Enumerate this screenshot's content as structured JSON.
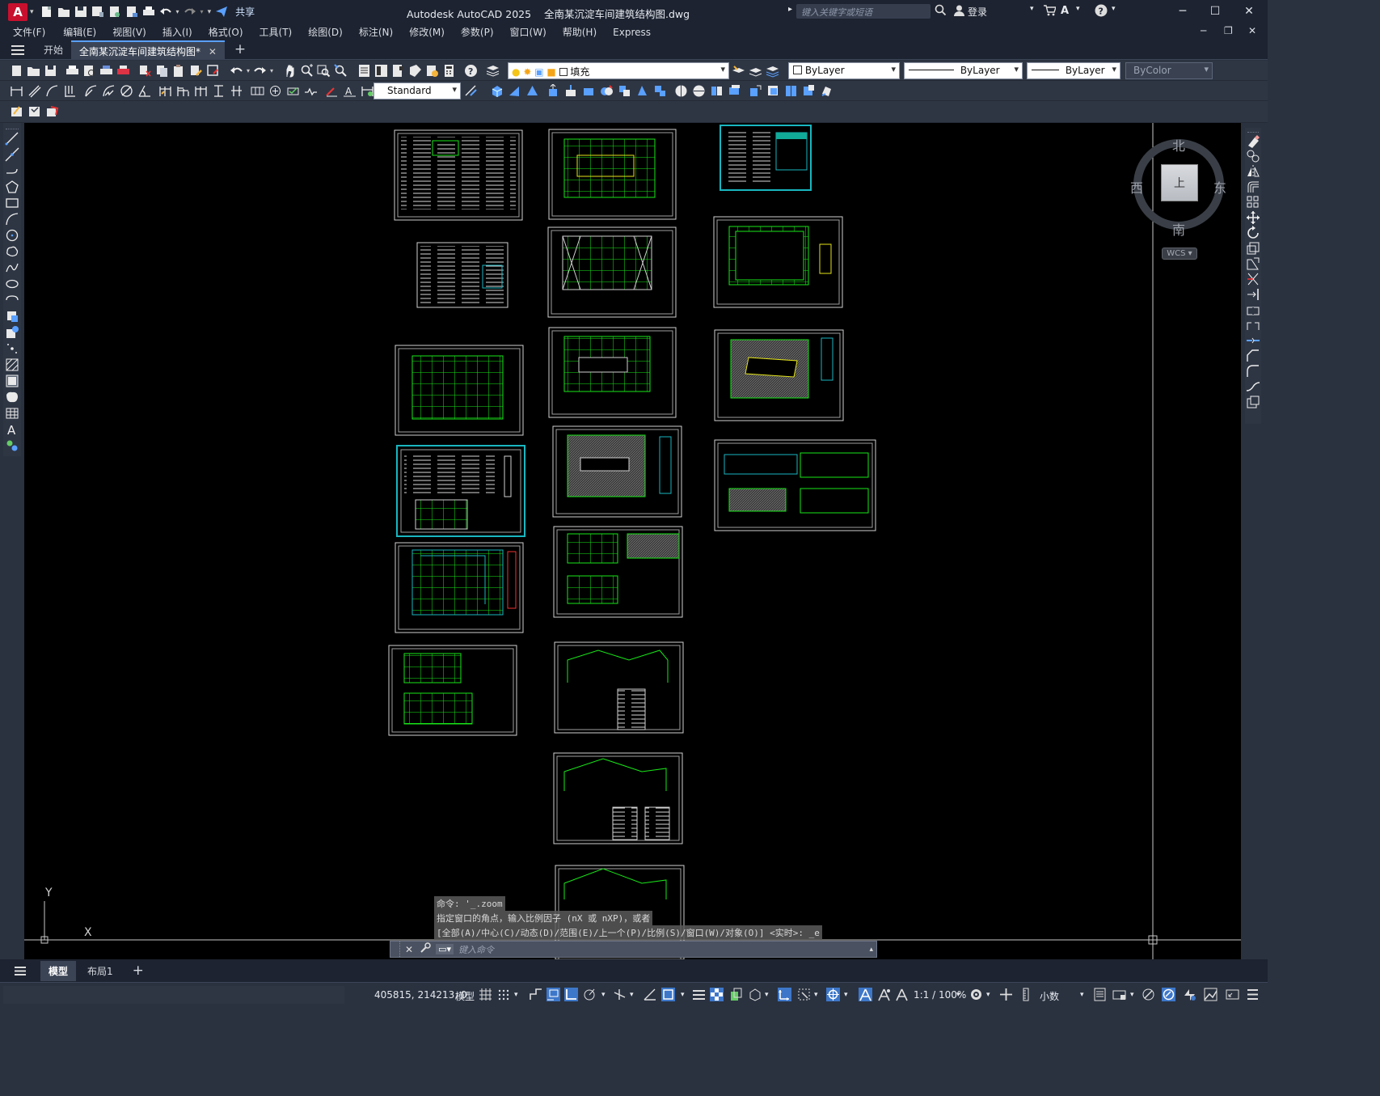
{
  "app": {
    "title": "Autodesk AutoCAD 2025",
    "filename": "全南某沉淀车间建筑结构图.dwg",
    "logo": "A",
    "share_label": "共享",
    "search_placeholder": "键入关键字或短语",
    "login_label": "登录"
  },
  "menu": [
    "文件(F)",
    "编辑(E)",
    "视图(V)",
    "插入(I)",
    "格式(O)",
    "工具(T)",
    "绘图(D)",
    "标注(N)",
    "修改(M)",
    "参数(P)",
    "窗口(W)",
    "帮助(H)",
    "Express"
  ],
  "file_tabs": {
    "start": "开始",
    "active": "全南某沉淀车间建筑结构图*"
  },
  "properties": {
    "layer": "填充",
    "color": "ByLayer",
    "linetype": "ByLayer",
    "lineweight": "ByLayer",
    "plotstyle": "ByColor",
    "text_style": "Standard"
  },
  "viewcube": {
    "north": "北",
    "south": "南",
    "east": "东",
    "west": "西",
    "top_face": "上",
    "wcs": "WCS"
  },
  "ucs": {
    "x_label": "X",
    "y_label": "Y"
  },
  "command": {
    "history": [
      "命令: '_.zoom",
      "指定窗口的角点，输入比例因子 (nX 或 nXP)，或者",
      "[全部(A)/中心(C)/动态(D)/范围(E)/上一个(P)/比例(S)/窗口(W)/对象(O)] <实时>: _e"
    ],
    "placeholder": "键入命令"
  },
  "layout_tabs": {
    "model": "模型",
    "layout1": "布局1"
  },
  "status": {
    "coords": "405815, 214213, 0",
    "space": "模型",
    "scale": "1:1 / 100%",
    "units": "小数"
  },
  "colors": {
    "accent": "#5aa0ff",
    "drawing_green": "#19e619",
    "cyan_border": "#19b6c0",
    "autocad_red": "#c8102e"
  }
}
